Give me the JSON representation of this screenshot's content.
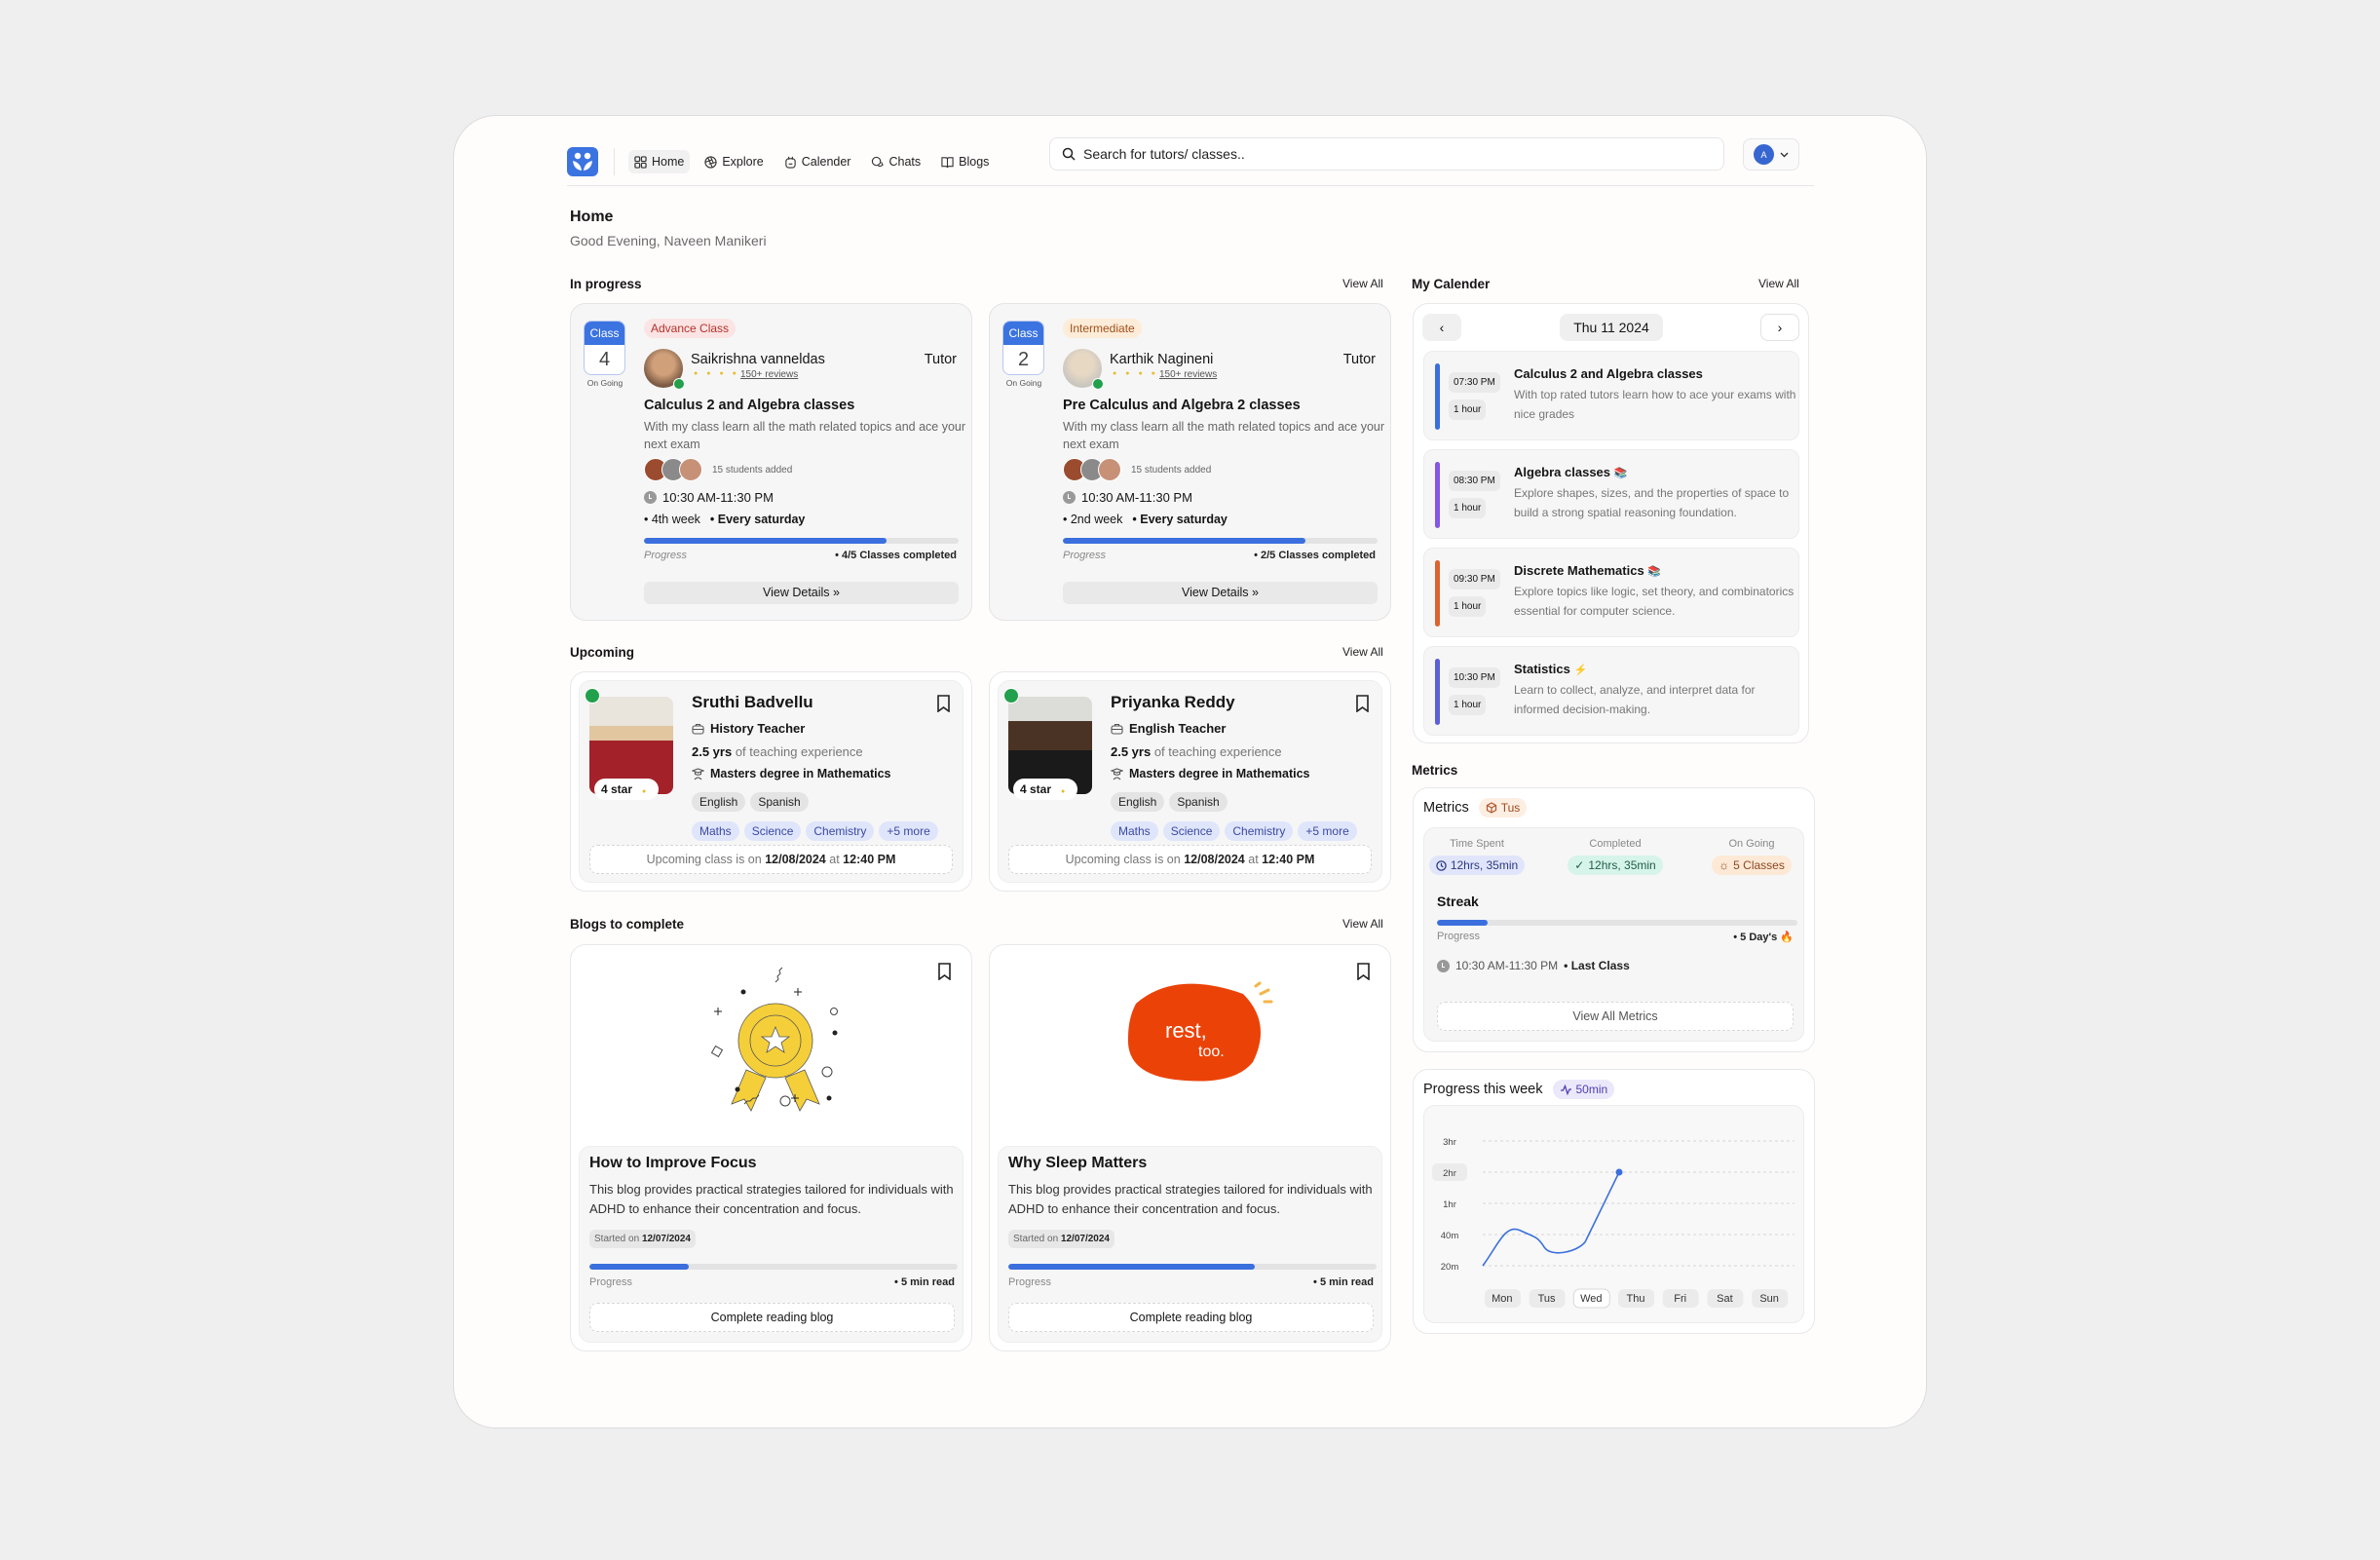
{
  "nav": {
    "items": [
      {
        "label": "Home",
        "icon": "grid-icon",
        "active": true
      },
      {
        "label": "Explore",
        "icon": "aperture-icon"
      },
      {
        "label": "Calender",
        "icon": "calendar-icon"
      },
      {
        "label": "Chats",
        "icon": "chat-icon"
      },
      {
        "label": "Blogs",
        "icon": "book-open-icon"
      }
    ],
    "search_placeholder": "Search for tutors/ classes..",
    "user_initial": "A"
  },
  "page": {
    "title": "Home",
    "greeting": "Good Evening, Naveen Manikeri"
  },
  "sections": {
    "in_progress": "In progress",
    "upcoming": "Upcoming",
    "blogs": "Blogs to complete",
    "calendar": "My Calender",
    "metrics": "Metrics",
    "view_all": "View All"
  },
  "in_progress": [
    {
      "class_label": "Class",
      "class_num": "4",
      "status": "On Going",
      "level": "Advance Class",
      "level_color": "#b4322c",
      "level_bg": "#fbe4e3",
      "tutor": "Saikrishna vanneldas",
      "role": "Tutor",
      "rating_stars": 4,
      "reviews": "150+ reviews",
      "title": "Calculus 2 and Algebra classes",
      "desc": "With my class learn all the math related topics and ace your next exam",
      "students": "15 students added",
      "time": "10:30 AM-11:30 PM",
      "week": "4th week",
      "schedule": "Every saturday",
      "progress_label": "Progress",
      "progress": 0.77,
      "progress_text": "4/5 Classes completed",
      "button": "View Details"
    },
    {
      "class_label": "Class",
      "class_num": "2",
      "status": "On Going",
      "level": "Intermediate",
      "level_color": "#a0501a",
      "level_bg": "#fdecd8",
      "tutor": "Karthik Nagineni",
      "role": "Tutor",
      "rating_stars": 4,
      "reviews": "150+ reviews",
      "title": "Pre Calculus and Algebra 2 classes",
      "desc": "With my class learn all the math related topics and ace your next exam",
      "students": "15 students added",
      "time": "10:30 AM-11:30 PM",
      "week": "2nd week",
      "schedule": "Every saturday",
      "progress_label": "Progress",
      "progress": 0.77,
      "progress_text": "2/5 Classes completed",
      "button": "View Details"
    }
  ],
  "upcoming": [
    {
      "name": "Sruthi Badvellu",
      "role": "History Teacher",
      "exp_value": "2.5 yrs",
      "exp_text": "of teaching experience",
      "degree": "Masters degree in Mathematics",
      "rating": "4 star",
      "languages": [
        "English",
        "Spanish"
      ],
      "subjects": [
        "Maths",
        "Science",
        "Chemistry",
        "+5 more"
      ],
      "next_prefix": "Upcoming class is on",
      "next_date": "12/08/2024",
      "next_at": "at",
      "next_time": "12:40 PM"
    },
    {
      "name": "Priyanka Reddy",
      "role": "English Teacher",
      "exp_value": "2.5 yrs",
      "exp_text": "of teaching experience",
      "degree": "Masters degree in Mathematics",
      "rating": "4 star",
      "languages": [
        "English",
        "Spanish"
      ],
      "subjects": [
        "Maths",
        "Science",
        "Chemistry",
        "+5 more"
      ],
      "next_prefix": "Upcoming class is on",
      "next_date": "12/08/2024",
      "next_at": "at",
      "next_time": "12:40 PM"
    }
  ],
  "blogs": [
    {
      "image": "award-ribbon-illustration",
      "title": "How to Improve Focus",
      "desc": "This blog provides practical strategies tailored for individuals with ADHD to enhance their concentration and focus.",
      "started_prefix": "Started on",
      "started_date": "12/07/2024",
      "progress_label": "Progress",
      "progress": 0.27,
      "read_time": "5 min read",
      "button": "Complete reading blog"
    },
    {
      "image": "rest-too-illustration",
      "image_text_1": "rest,",
      "image_text_2": "too.",
      "title": "Why Sleep Matters",
      "desc": "This blog provides practical strategies tailored for individuals with ADHD to enhance their concentration and focus.",
      "started_prefix": "Started on",
      "started_date": "12/07/2024",
      "progress_label": "Progress",
      "progress": 0.67,
      "read_time": "5 min read",
      "button": "Complete reading blog"
    }
  ],
  "calendar": {
    "date": "Thu 11 2024",
    "events": [
      {
        "time": "07:30 PM",
        "duration": "1 hour",
        "title": "Calculus 2 and Algebra classes",
        "emoji": "",
        "desc": "With top rated tutors learn how to ace your exams with nice grades",
        "color": "#3b6fdd"
      },
      {
        "time": "08:30 PM",
        "duration": "1 hour",
        "title": "Algebra classes",
        "emoji": "📚",
        "desc": "Explore shapes, sizes, and the properties of space to build a strong spatial reasoning foundation.",
        "color": "#8457e6"
      },
      {
        "time": "09:30 PM",
        "duration": "1 hour",
        "title": "Discrete Mathematics",
        "emoji": "📚",
        "desc": "Explore topics like logic, set theory, and combinatorics essential for computer science.",
        "color": "#dc6330"
      },
      {
        "time": "10:30 PM",
        "duration": "1 hour",
        "title": "Statistics",
        "emoji": "⚡",
        "desc": "Learn to collect, analyze, and interpret data for informed decision-making.",
        "color": "#5b5fd8"
      }
    ]
  },
  "metrics": {
    "title": "Metrics",
    "day_badge": "Tus",
    "time_spent_label": "Time Spent",
    "time_spent": "12hrs, 35min",
    "completed_label": "Completed",
    "completed": "12hrs, 35min",
    "ongoing_label": "On Going",
    "ongoing": "5 Classes",
    "streak_title": "Streak",
    "streak_progress": 0.14,
    "progress_label": "Progress",
    "streak_value": "5 Day's 🔥",
    "last_time": "10:30 AM-11:30 PM",
    "last_label": "Last Class",
    "button": "View All Metrics"
  },
  "progress_week": {
    "title": "Progress this week",
    "badge": "50min"
  },
  "chart_data": {
    "type": "line",
    "title": "Progress this week",
    "categories": [
      "Mon",
      "Tus",
      "Wed",
      "Thu",
      "Fri",
      "Sat",
      "Sun"
    ],
    "y_ticks": [
      "20m",
      "40m",
      "1hr",
      "2hr",
      "3hr"
    ],
    "highlight_tick": "2hr",
    "selected_category": "Wed",
    "series": [
      {
        "name": "Time spent",
        "values_tick_index": [
          0,
          1.2,
          0.6,
          3.0
        ]
      }
    ],
    "grid": true
  }
}
